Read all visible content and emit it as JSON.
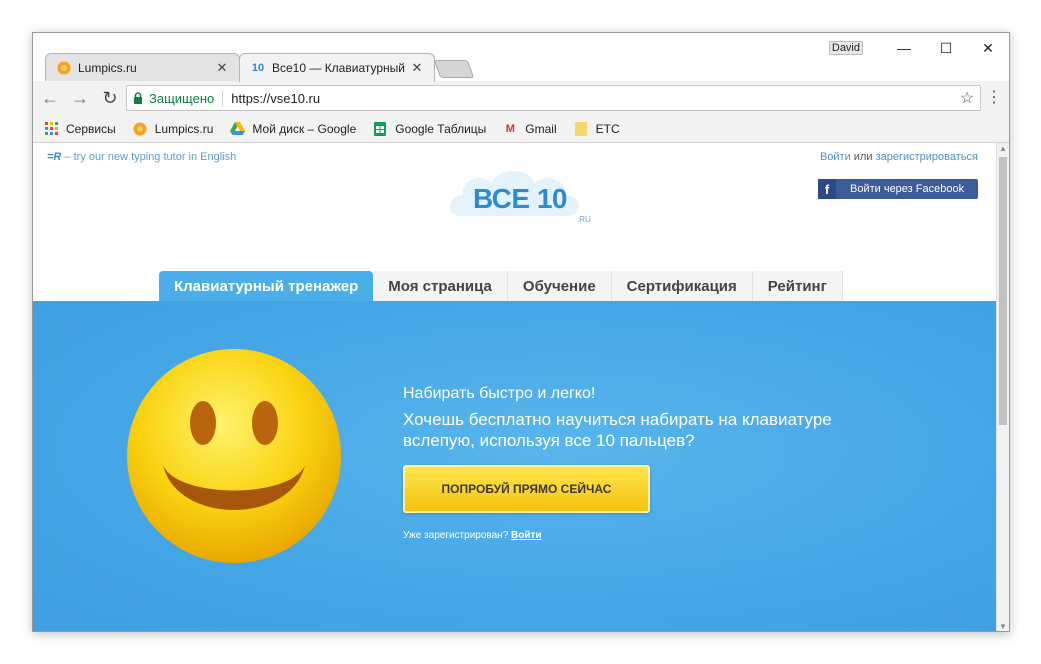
{
  "browser": {
    "tabs": [
      {
        "title": "Lumpics.ru",
        "favicon": "orange-circle-icon"
      },
      {
        "title": "Все10 — Клавиатурный",
        "favicon": "10"
      }
    ],
    "user": "David",
    "address": {
      "secure_label": "Защищено",
      "url": "https://vse10.ru"
    },
    "bookmarks": [
      {
        "label": "Сервисы",
        "icon": "apps-grid-icon"
      },
      {
        "label": "Lumpics.ru",
        "icon": "orange-circle-icon"
      },
      {
        "label": "Мой диск – Google",
        "icon": "google-drive-icon"
      },
      {
        "label": "Google Таблицы",
        "icon": "sheets-icon"
      },
      {
        "label": "Gmail",
        "icon": "gmail-icon"
      },
      {
        "label": "ETC",
        "icon": "folder-icon"
      }
    ]
  },
  "page": {
    "promo_prefix": "=R",
    "promo_text": " – try our new typing tutor in English",
    "auth": {
      "login": "Войти",
      "or": " или ",
      "register": "зарегистрироваться"
    },
    "facebook_button": "Войти через Facebook",
    "logo": {
      "text": "ВСЕ 10",
      "suffix": ".RU"
    },
    "nav": [
      "Клавиатурный тренажер",
      "Моя страница",
      "Обучение",
      "Сертификация",
      "Рейтинг"
    ],
    "hero": {
      "line1": "Набирать быстро и легко!",
      "line2": "Хочешь бесплатно научиться набирать на клавиатуре вслепую, используя все 10 пальцев?",
      "cta": "ПОПРОБУЙ ПРЯМО СЕЙЧАС",
      "already_text": "Уже зарегистрирован? ",
      "already_link": "Войти"
    }
  },
  "colors": {
    "hero_blue": "#45a7e6",
    "nav_active": "#4aaee8",
    "cta_yellow": "#f6c20d",
    "secure_green": "#0b8043",
    "facebook_blue": "#3b5b99"
  }
}
